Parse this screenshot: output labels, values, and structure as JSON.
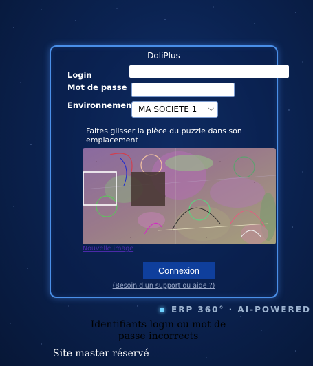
{
  "form": {
    "title": "DoliPlus",
    "login_label": "Login",
    "login_value": "",
    "password_label": "Mot de passe",
    "password_value": "",
    "environment_label": "Environnement",
    "environment_selected": "MA SOCIETE 1",
    "puzzle_hint": "Faites glisser la pièce du puzzle dans son emplacement",
    "new_image_link": "Nouvelle image",
    "connect_button": "Connexion",
    "help_link": "(Besoin d'un support ou aide ?)"
  },
  "branding": {
    "erp_tagline": "ERP 360° · AI-POWERED"
  },
  "messages": {
    "error": "Identifiants login ou mot de passe incorrects",
    "site_master": "Site master réservé"
  },
  "colors": {
    "accent_border": "#4a8fe8",
    "button_bg": "#0f3f9c",
    "background": "#0b2352"
  }
}
